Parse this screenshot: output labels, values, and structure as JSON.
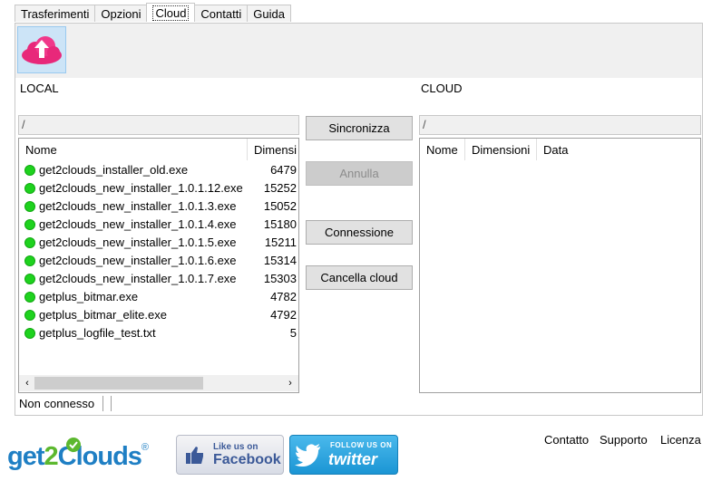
{
  "tabs": [
    {
      "label": "Trasferimenti",
      "active": false
    },
    {
      "label": "Opzioni",
      "active": false
    },
    {
      "label": "Cloud",
      "active": true
    },
    {
      "label": "Contatti",
      "active": false
    },
    {
      "label": "Guida",
      "active": false
    }
  ],
  "toolbar": {
    "upload_icon": "cloud-upload-icon"
  },
  "local": {
    "title": "LOCAL",
    "path": "/",
    "columns": [
      "Nome",
      "Dimensi"
    ],
    "files": [
      {
        "name": "get2clouds_installer_old.exe",
        "size": "6479"
      },
      {
        "name": "get2clouds_new_installer_1.0.1.12.exe",
        "size": "15252"
      },
      {
        "name": "get2clouds_new_installer_1.0.1.3.exe",
        "size": "15052"
      },
      {
        "name": "get2clouds_new_installer_1.0.1.4.exe",
        "size": "15180"
      },
      {
        "name": "get2clouds_new_installer_1.0.1.5.exe",
        "size": "15211"
      },
      {
        "name": "get2clouds_new_installer_1.0.1.6.exe",
        "size": "15314"
      },
      {
        "name": "get2clouds_new_installer_1.0.1.7.exe",
        "size": "15303"
      },
      {
        "name": "getplus_bitmar.exe",
        "size": "4782"
      },
      {
        "name": "getplus_bitmar_elite.exe",
        "size": "4792"
      },
      {
        "name": "getplus_logfile_test.txt",
        "size": "5"
      }
    ]
  },
  "cloud": {
    "title": "CLOUD",
    "path": "/",
    "columns": [
      "Nome",
      "Dimensioni",
      "Data"
    ]
  },
  "actions": {
    "sync": "Sincronizza",
    "cancel": "Annulla",
    "connect": "Connessione",
    "delete_cloud": "Cancella cloud"
  },
  "status": {
    "text": "Non connesso"
  },
  "footer": {
    "links": [
      "Contatto",
      "Supporto",
      "Licenza"
    ],
    "logo_part1": "get",
    "logo_part2": "2",
    "logo_part3": "Clouds",
    "logo_reg": "®",
    "facebook_small": "Like us on",
    "facebook_big": "Facebook",
    "twitter_small": "FOLLOW US ON",
    "twitter_big": "twitter"
  },
  "colors": {
    "status_ok": "#1ed21e",
    "brand_blue": "#1f7fc4",
    "brand_green": "#5cb82f",
    "cloud_pink": "#e8287a"
  }
}
